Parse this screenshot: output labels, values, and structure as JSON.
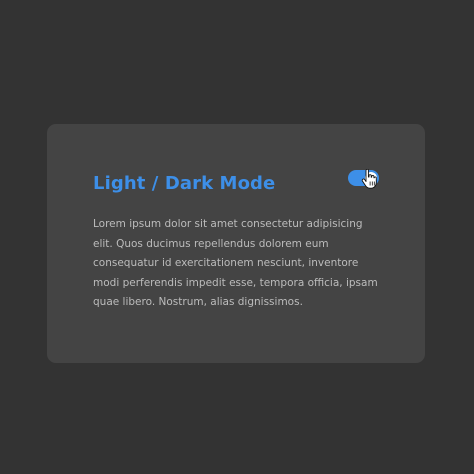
{
  "card": {
    "title": "Light / Dark Mode",
    "toggle": {
      "state": "on",
      "accent_color": "#3d8fe8"
    },
    "paragraph": "Lorem ipsum dolor sit amet consectetur adipisicing elit. Quos ducimus repellendus dolorem eum consequatur id exercitationem nesciunt, inventore modi perferendis impedit esse, tempora officia, ipsam quae libero. Nostrum, alias dignissimos."
  },
  "colors": {
    "page_background": "#333333",
    "card_background": "#444444",
    "accent": "#3d8fe8",
    "body_text": "#bcbcbc"
  },
  "icons": {
    "cursor": "hand-pointer-icon"
  }
}
